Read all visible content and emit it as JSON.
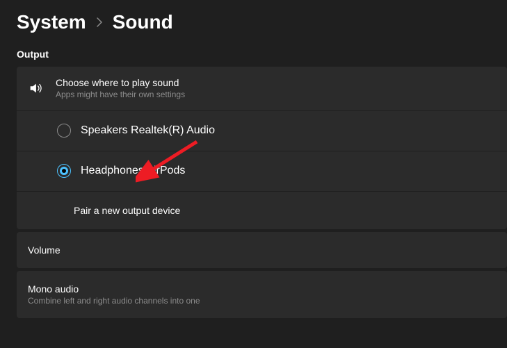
{
  "breadcrumb": {
    "parent": "System",
    "current": "Sound"
  },
  "output_section": {
    "label": "Output",
    "choose": {
      "title": "Choose where to play sound",
      "sub": "Apps might have their own settings"
    },
    "devices": [
      {
        "name": "Speakers",
        "detail": "Realtek(R) Audio",
        "selected": false
      },
      {
        "name": "Headphones",
        "detail": "AirPods",
        "selected": true
      }
    ],
    "pair_link": "Pair a new output device"
  },
  "volume_card": {
    "title": "Volume"
  },
  "mono_card": {
    "title": "Mono audio",
    "sub": "Combine left and right audio channels into one"
  },
  "annotation": {
    "arrow_color": "#ed1c24"
  }
}
